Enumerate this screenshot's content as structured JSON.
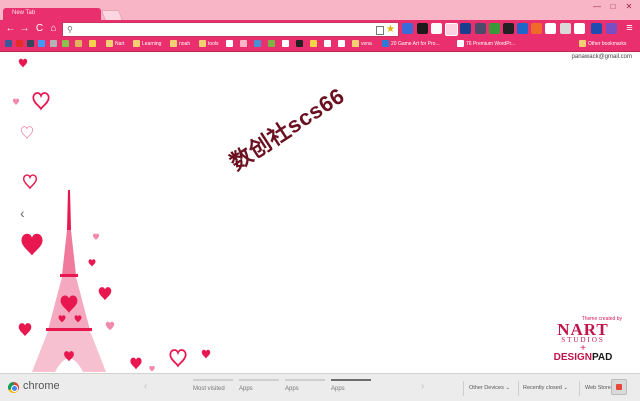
{
  "window": {
    "tab_title": "New Tab",
    "controls": {
      "minimize": "—",
      "maximize": "□",
      "close": "✕"
    }
  },
  "toolbar": {
    "back": "←",
    "forward": "→",
    "reload": "C",
    "home": "⌂",
    "menu": "≡",
    "star": "★"
  },
  "bookmarks": [
    {
      "label": "Nart",
      "folder": true
    },
    {
      "label": "Learning",
      "folder": true
    },
    {
      "label": "noah",
      "folder": true
    },
    {
      "label": "tools",
      "folder": true
    },
    {
      "label": "vena",
      "folder": true
    },
    {
      "label": "20 Game Art for Pro...",
      "folder": false
    },
    {
      "label": "76 Premium WordPr...",
      "folder": false
    },
    {
      "label": "Other bookmarks",
      "folder": true
    }
  ],
  "content": {
    "account": "panawack@gmail.com",
    "watermark": "数创社scs66",
    "prev_arrow": "‹"
  },
  "credit": {
    "theme_created_by": "Theme created by",
    "nart": "NART",
    "studios": "STUDIOS",
    "plus": "+",
    "design": "DESIGN",
    "pad": "PAD"
  },
  "ntp": {
    "brand": "chrome",
    "left_chevron": "‹",
    "right_chevron": "›",
    "tabs": [
      {
        "label": "Most visited",
        "active": false
      },
      {
        "label": "Apps",
        "active": false
      },
      {
        "label": "Apps",
        "active": false
      },
      {
        "label": "Apps",
        "active": true
      }
    ],
    "other_devices": "Other Devices ⌄",
    "recently_closed": "Recently closed ⌄",
    "web_store": "Web Store"
  },
  "colors": {
    "tab_strip": "#f7b5c6",
    "toolbar": "#ea2f6f",
    "heart": "#e8174f",
    "credit": "#c0154b"
  }
}
